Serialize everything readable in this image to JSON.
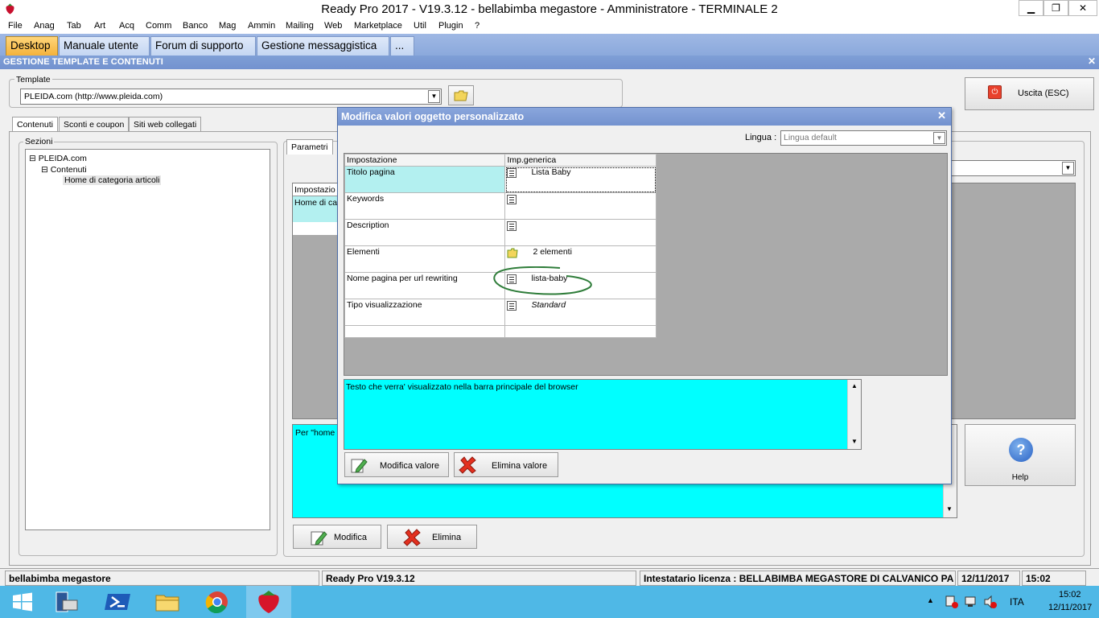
{
  "window": {
    "title": "Ready Pro 2017 - V19.3.12 - bellabimba megastore - Amministratore - TERMINALE 2",
    "minimize": "▁",
    "restore": "❐",
    "close": "✕"
  },
  "menu": [
    "File",
    "Anag",
    "Tab",
    "Art",
    "Acq",
    "Comm",
    "Banco",
    "Mag",
    "Ammin",
    "Mailing",
    "Web",
    "Marketplace",
    "Util",
    "Plugin",
    "?"
  ],
  "top_tabs": [
    "Desktop",
    "Manuale utente",
    "Forum di supporto",
    "Gestione messaggistica",
    "..."
  ],
  "section": {
    "title": "GESTIONE TEMPLATE E CONTENUTI",
    "close": "✕"
  },
  "template": {
    "label": "Template",
    "value": "PLEIDA.com (http://www.pleida.com)"
  },
  "exit_button": "Uscita (ESC)",
  "sub_tabs": [
    "Contenuti",
    "Sconti e coupon",
    "Siti web collegati"
  ],
  "sections": {
    "label": "Sezioni",
    "tree": [
      "PLEIDA.com",
      "Contenuti",
      "Home di categoria articoli"
    ]
  },
  "right_panel": {
    "tab": "Parametri",
    "grid_header": "Impostazio",
    "grid_row": "Home di ca",
    "desc_text": "Per \"home d",
    "modifica": "Modifica",
    "elimina": "Elimina",
    "help": "Help"
  },
  "dialog": {
    "title": "Modifica valori oggetto personalizzato",
    "close": "✕",
    "lingua_label": "Lingua :",
    "lingua_value": "Lingua default",
    "columns": [
      "Impostazione",
      "Imp.generica"
    ],
    "rows": [
      {
        "setting": "Titolo pagina",
        "value": "Lista Baby",
        "icon": "text-icon"
      },
      {
        "setting": "Keywords",
        "value": "",
        "icon": "text-icon"
      },
      {
        "setting": "Description",
        "value": "",
        "icon": "text-icon"
      },
      {
        "setting": "Elementi",
        "value": "2 elementi",
        "icon": "folder-icon"
      },
      {
        "setting": "Nome pagina per url rewriting",
        "value": "lista-baby",
        "icon": "text-icon"
      },
      {
        "setting": "Tipo visualizzazione",
        "value": "Standard",
        "icon": "text-icon"
      }
    ],
    "description": "Testo che verra' visualizzato nella barra principale del browser",
    "modifica_valore": "Modifica valore",
    "elimina_valore": "Elimina valore"
  },
  "status": {
    "company": "bellabimba megastore",
    "version": "Ready Pro V19.3.12",
    "license": "Intestatario licenza : BELLABIMBA MEGASTORE DI CALVANICO PA",
    "date": "12/11/2017",
    "time": "15:02"
  },
  "taskbar": {
    "lang": "ITA",
    "time": "15:02",
    "date": "12/11/2017"
  },
  "colors": {
    "accent": "#7392cf",
    "cyan": "#00ffff",
    "taskbar": "#4fb8e6",
    "active_tab": "#f4b23b"
  }
}
